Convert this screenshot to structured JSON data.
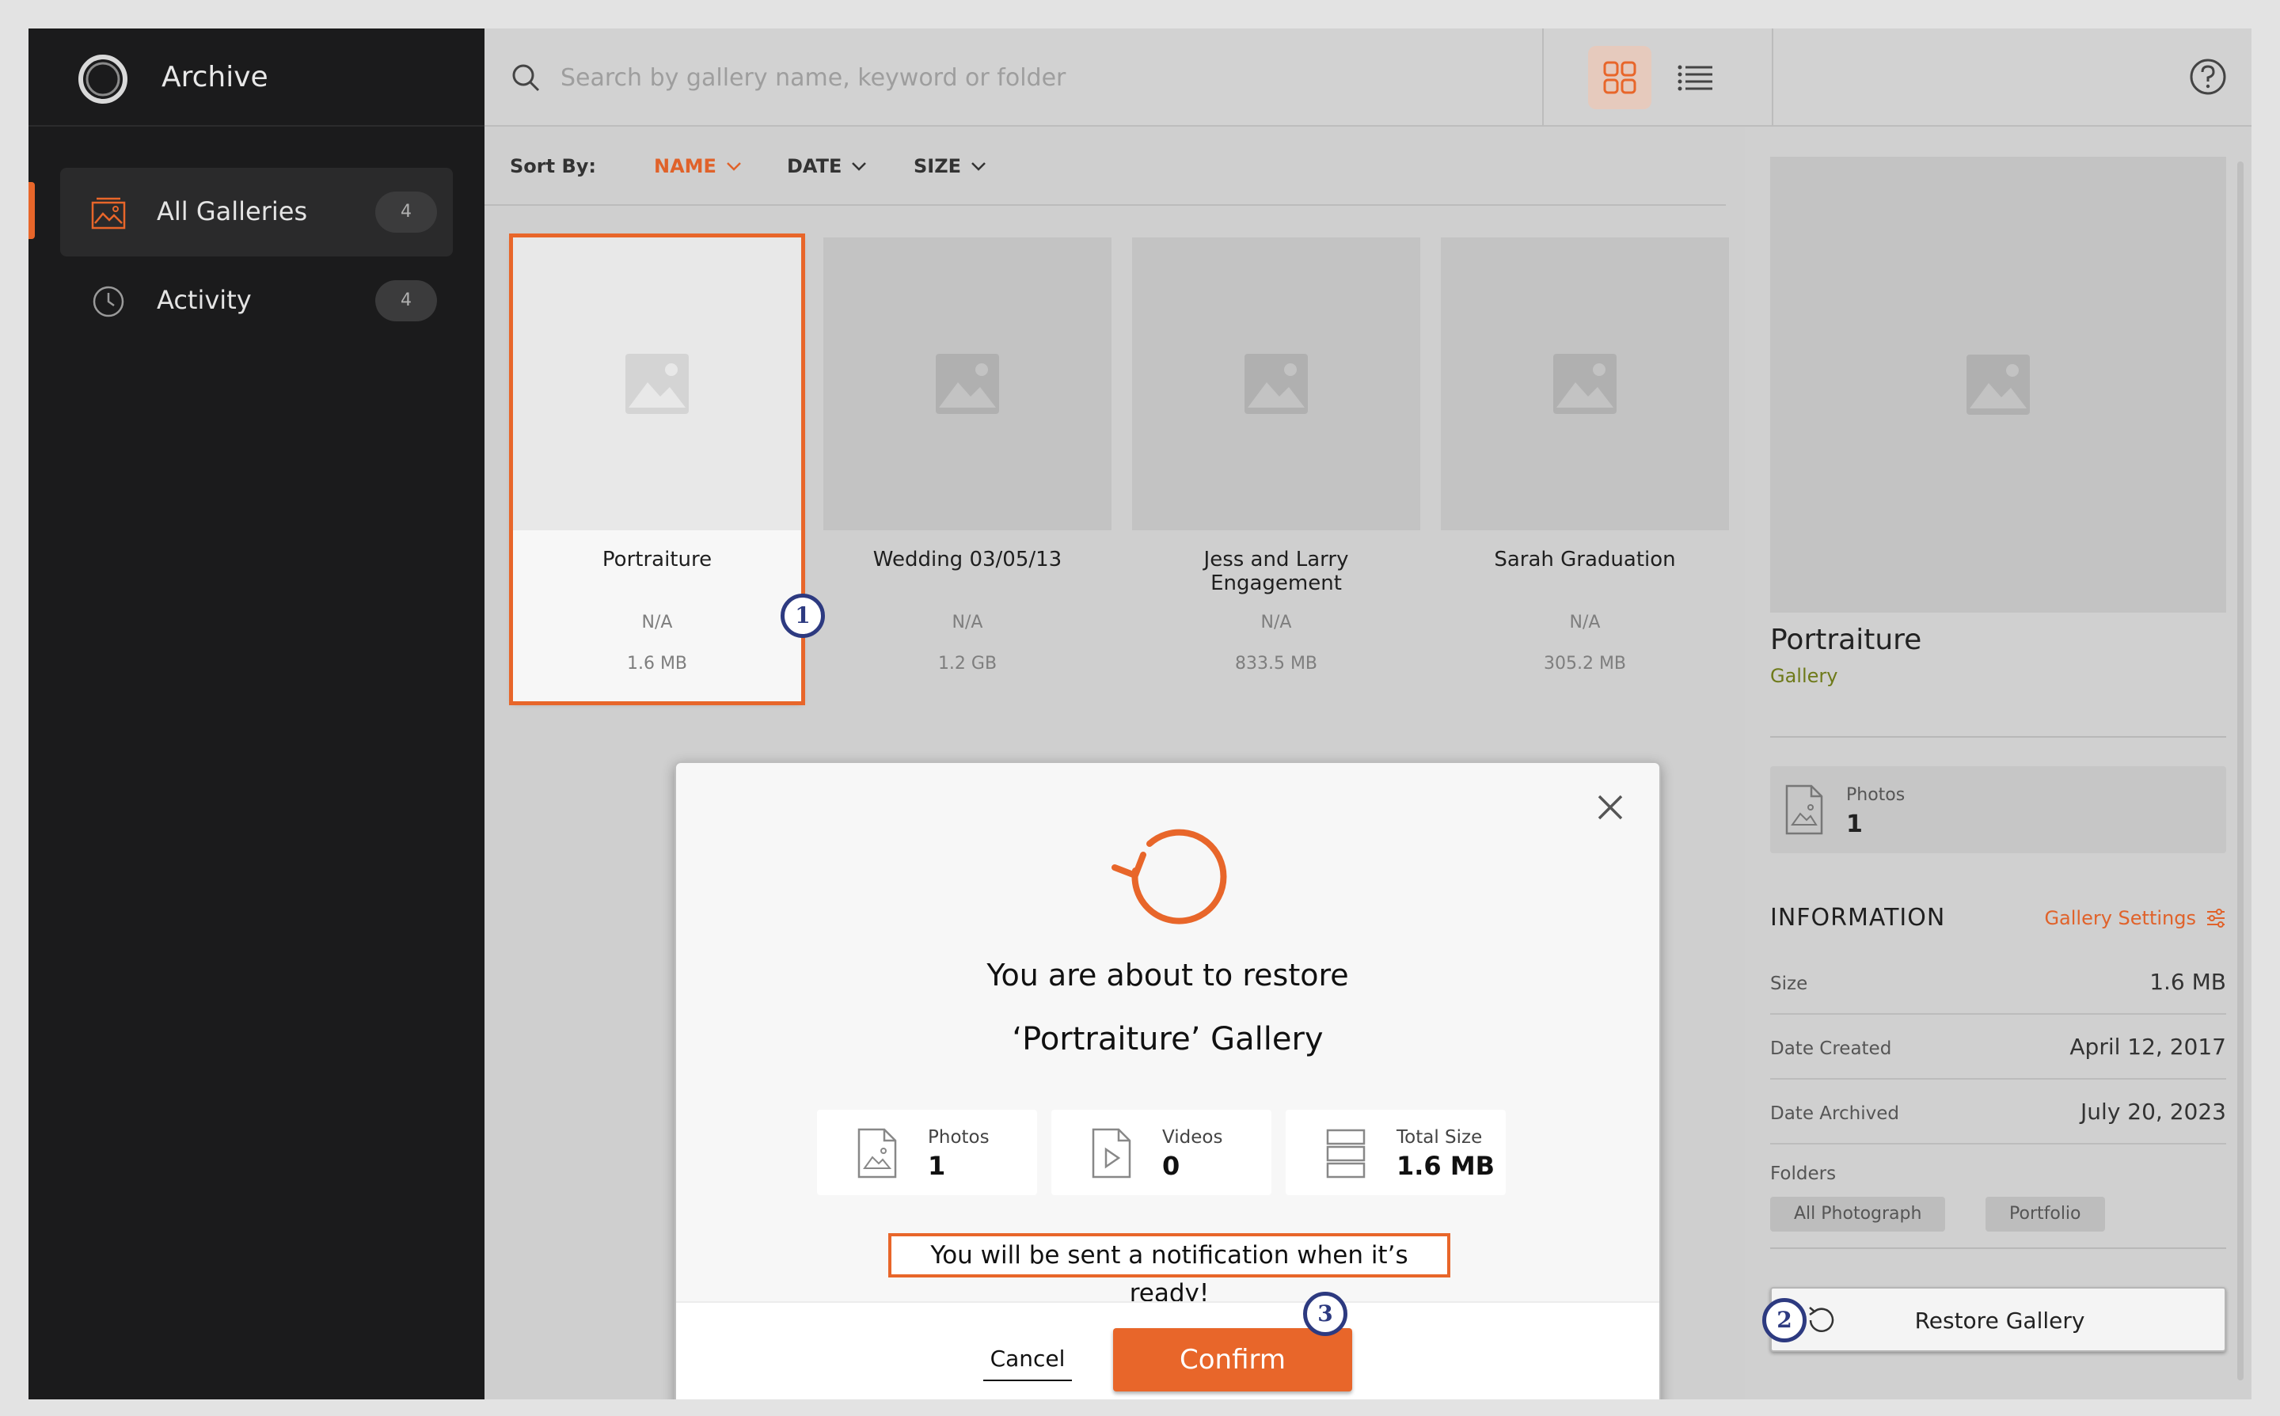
{
  "app": {
    "title": "Archive"
  },
  "sidebar": {
    "items": [
      {
        "label": "All Galleries",
        "count": "4",
        "icon": "gallery-icon",
        "active": true
      },
      {
        "label": "Activity",
        "count": "4",
        "icon": "clock-icon",
        "active": false
      }
    ]
  },
  "search": {
    "placeholder": "Search by gallery name, keyword or folder",
    "value": ""
  },
  "sort": {
    "label": "Sort By:",
    "options": [
      {
        "label": "NAME",
        "active": true
      },
      {
        "label": "DATE",
        "active": false
      },
      {
        "label": "SIZE",
        "active": false
      }
    ]
  },
  "galleries": [
    {
      "name": "Portraiture",
      "date": "N/A",
      "size": "1.6 MB",
      "selected": true
    },
    {
      "name": "Wedding 03/05/13",
      "date": "N/A",
      "size": "1.2 GB",
      "selected": false
    },
    {
      "name": "Jess and Larry Engagement",
      "date": "N/A",
      "size": "833.5 MB",
      "selected": false
    },
    {
      "name": "Sarah Graduation",
      "date": "N/A",
      "size": "305.2 MB",
      "selected": false
    }
  ],
  "detail": {
    "title": "Portraiture",
    "subtitle": "Gallery",
    "photos_label": "Photos",
    "photos_count": "1",
    "info_heading": "INFORMATION",
    "settings_link": "Gallery Settings",
    "rows": [
      {
        "key": "Size",
        "value": "1.6 MB"
      },
      {
        "key": "Date Created",
        "value": "April 12, 2017"
      },
      {
        "key": "Date Archived",
        "value": "July 20, 2023"
      }
    ],
    "folders_label": "Folders",
    "folders": [
      "All Photograph",
      "Portfolio"
    ],
    "restore_label": "Restore Gallery"
  },
  "modal": {
    "line1": "You are about to restore",
    "line2": "‘Portraiture’ Gallery",
    "stats": [
      {
        "label": "Photos",
        "value": "1",
        "icon": "photo-file-icon"
      },
      {
        "label": "Videos",
        "value": "0",
        "icon": "video-file-icon"
      },
      {
        "label": "Total Size",
        "value": "1.6 MB",
        "icon": "storage-icon"
      }
    ],
    "notice": "You will be sent a notification when it’s ready!",
    "cancel_label": "Cancel",
    "confirm_label": "Confirm"
  },
  "steps": [
    "1",
    "2",
    "3"
  ],
  "colors": {
    "accent": "#e8662a",
    "sidebar": "#1b1b1c",
    "step": "#2d3a80"
  }
}
